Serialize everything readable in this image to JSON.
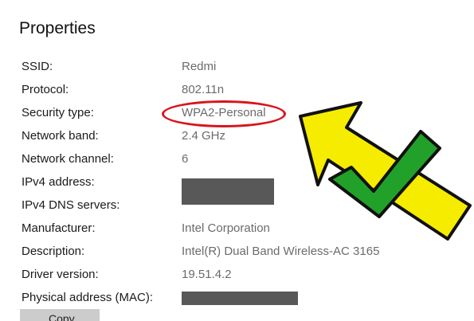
{
  "title": "Properties",
  "rows": [
    {
      "label": "SSID:",
      "value": "Redmi"
    },
    {
      "label": "Protocol:",
      "value": "802.11n"
    },
    {
      "label": "Security type:",
      "value": "WPA2-Personal"
    },
    {
      "label": "Network band:",
      "value": "2.4 GHz"
    },
    {
      "label": "Network channel:",
      "value": "6"
    },
    {
      "label": "IPv4 address:",
      "value": null
    },
    {
      "label": "IPv4 DNS servers:",
      "value": null
    },
    {
      "label": "Manufacturer:",
      "value": "Intel Corporation"
    },
    {
      "label": "Description:",
      "value": "Intel(R) Dual Band Wireless-AC 3165"
    },
    {
      "label": "Driver version:",
      "value": "19.51.4.2"
    },
    {
      "label": "Physical address (MAC):",
      "value": null
    }
  ],
  "copy_button": {
    "label": "Copy"
  },
  "colors": {
    "highlight_oval": "#d8141c",
    "arrow_fill": "#f5ec00",
    "check_fill": "#21a12a",
    "redaction": "#585858"
  },
  "icons": [
    "arrow-icon",
    "checkmark-icon"
  ]
}
